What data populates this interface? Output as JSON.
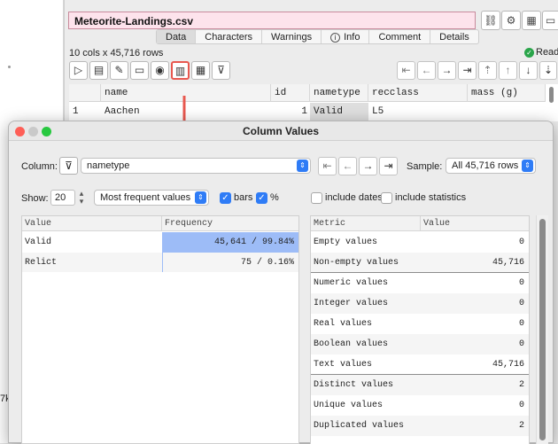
{
  "main": {
    "file_name": "Meteorite-Landings.csv",
    "rows_info": "10 cols x 45,716 rows",
    "ready": "Read",
    "tabs": [
      {
        "label": "Data",
        "selected": true
      },
      {
        "label": "Characters"
      },
      {
        "label": "Warnings"
      },
      {
        "label": "Info"
      },
      {
        "label": "Comment"
      },
      {
        "label": "Details"
      }
    ],
    "grid": {
      "headers": [
        "name",
        "id",
        "nametype",
        "recclass",
        "mass (g)"
      ],
      "row_number": "1",
      "row": [
        "Aachen",
        "1",
        "Valid",
        "L5",
        ""
      ]
    },
    "left_strip_text": "7k"
  },
  "dialog": {
    "title": "Column Values",
    "column_label": "Column:",
    "column_value": "nametype",
    "sample_label": "Sample:",
    "sample_value": "All 45,716 rows",
    "show_label": "Show:",
    "show_value": "20",
    "mode_value": "Most frequent values",
    "bars_label": "bars",
    "bars_checked": true,
    "percent_label": "%",
    "percent_checked": true,
    "include_dates_label": "include dates",
    "include_stats_label": "include statistics",
    "values_table": {
      "headers": [
        "Value",
        "Frequency"
      ],
      "rows": [
        {
          "value": "Valid",
          "frequency": "45,641 / 99.84%",
          "bar_fraction": 0.9984
        },
        {
          "value": "Relict",
          "frequency": "75 /  0.16%",
          "bar_fraction": 0.0016
        }
      ]
    },
    "metrics_table": {
      "headers": [
        "Metric",
        "Value"
      ],
      "rows": [
        {
          "metric": "Empty values",
          "value": "0"
        },
        {
          "metric": "Non-empty values",
          "value": "45,716"
        },
        {
          "metric": "Numeric values",
          "value": "0"
        },
        {
          "metric": "Integer values",
          "value": "0"
        },
        {
          "metric": "Real values",
          "value": "0"
        },
        {
          "metric": "Boolean values",
          "value": "0"
        },
        {
          "metric": "Text values",
          "value": "45,716"
        },
        {
          "metric": "Distinct values",
          "value": "2"
        },
        {
          "metric": "Unique values",
          "value": "0"
        },
        {
          "metric": "Duplicated values",
          "value": "2"
        }
      ]
    }
  },
  "colors": {
    "accent": "#2f7cf6",
    "bar": "#9dbcf7",
    "ready_green": "#2aa54a",
    "highlight_arrow": "#e8584f"
  }
}
